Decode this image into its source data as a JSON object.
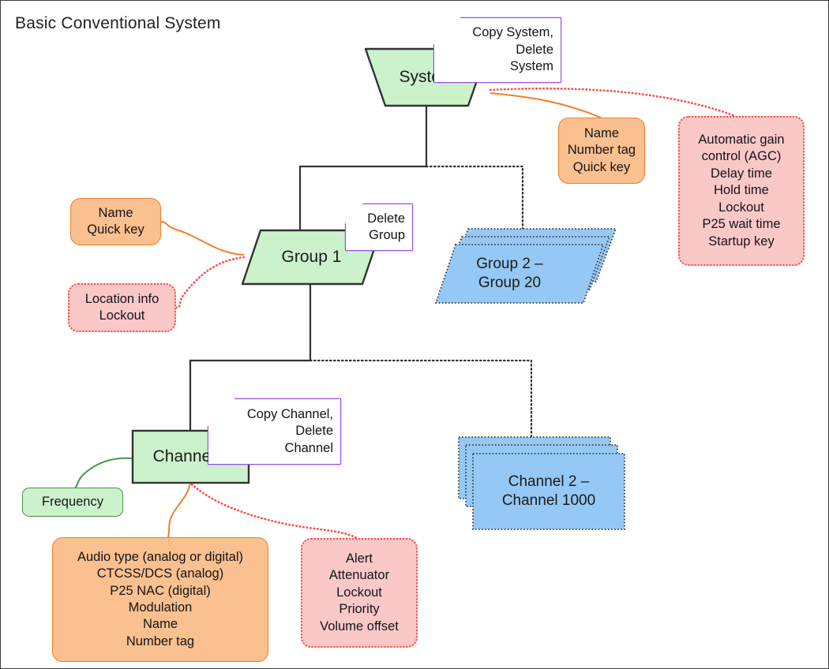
{
  "diagram": {
    "title": "Basic Conventional System",
    "colors": {
      "node_fill": "#ccf2cc",
      "node_stroke": "#333333",
      "orange_fill": "#fac090",
      "orange_stroke": "#f07f2a",
      "pink_fill": "#fbc8c8",
      "pink_stroke": "#fb4a4a",
      "blue_fill": "#95c8f5",
      "blue_stroke": "#333333",
      "purple_stroke": "#9a50e0",
      "frequency_stroke": "#4a934a"
    },
    "nodes": {
      "system": {
        "label": "System",
        "shape": "trapezoid"
      },
      "group1": {
        "label": "Group 1",
        "shape": "parallelogram"
      },
      "channel1": {
        "label": "Channel 1",
        "shape": "rectangle"
      },
      "group_stack": {
        "label": "Group 2 –\nGroup 20",
        "line1": "Group 2 –",
        "line2": "Group 20",
        "shape": "stacked-parallelogram"
      },
      "channel_stack": {
        "label": "Channel 2 –\nChannel 1000",
        "line1": "Channel 2 –",
        "line2": "Channel 1000",
        "shape": "stacked-rectangle"
      }
    },
    "notes": {
      "system_note": {
        "lines": [
          "Copy System,",
          "Delete",
          "System"
        ]
      },
      "group_note": {
        "lines": [
          "Delete",
          "Group"
        ]
      },
      "channel_note": {
        "lines": [
          "Copy Channel,",
          "Delete",
          "Channel"
        ]
      }
    },
    "callouts": {
      "system_orange": {
        "lines": [
          "Name",
          "Number tag",
          "Quick key"
        ]
      },
      "system_pink": {
        "lines": [
          "Automatic gain",
          "control (AGC)",
          "Delay time",
          "Hold time",
          "Lockout",
          "P25 wait time",
          "Startup key"
        ]
      },
      "group_orange": {
        "lines": [
          "Name",
          "Quick key"
        ]
      },
      "group_pink": {
        "lines": [
          "Location info",
          "Lockout"
        ]
      },
      "channel_green": {
        "lines": [
          "Frequency"
        ]
      },
      "channel_orange": {
        "lines": [
          "Audio type (analog or digital)",
          "CTCSS/DCS (analog)",
          "P25 NAC (digital)",
          "Modulation",
          "Name",
          "Number tag"
        ]
      },
      "channel_pink": {
        "lines": [
          "Alert",
          "Attenuator",
          "Lockout",
          "Priority",
          "Volume offset"
        ]
      }
    }
  }
}
